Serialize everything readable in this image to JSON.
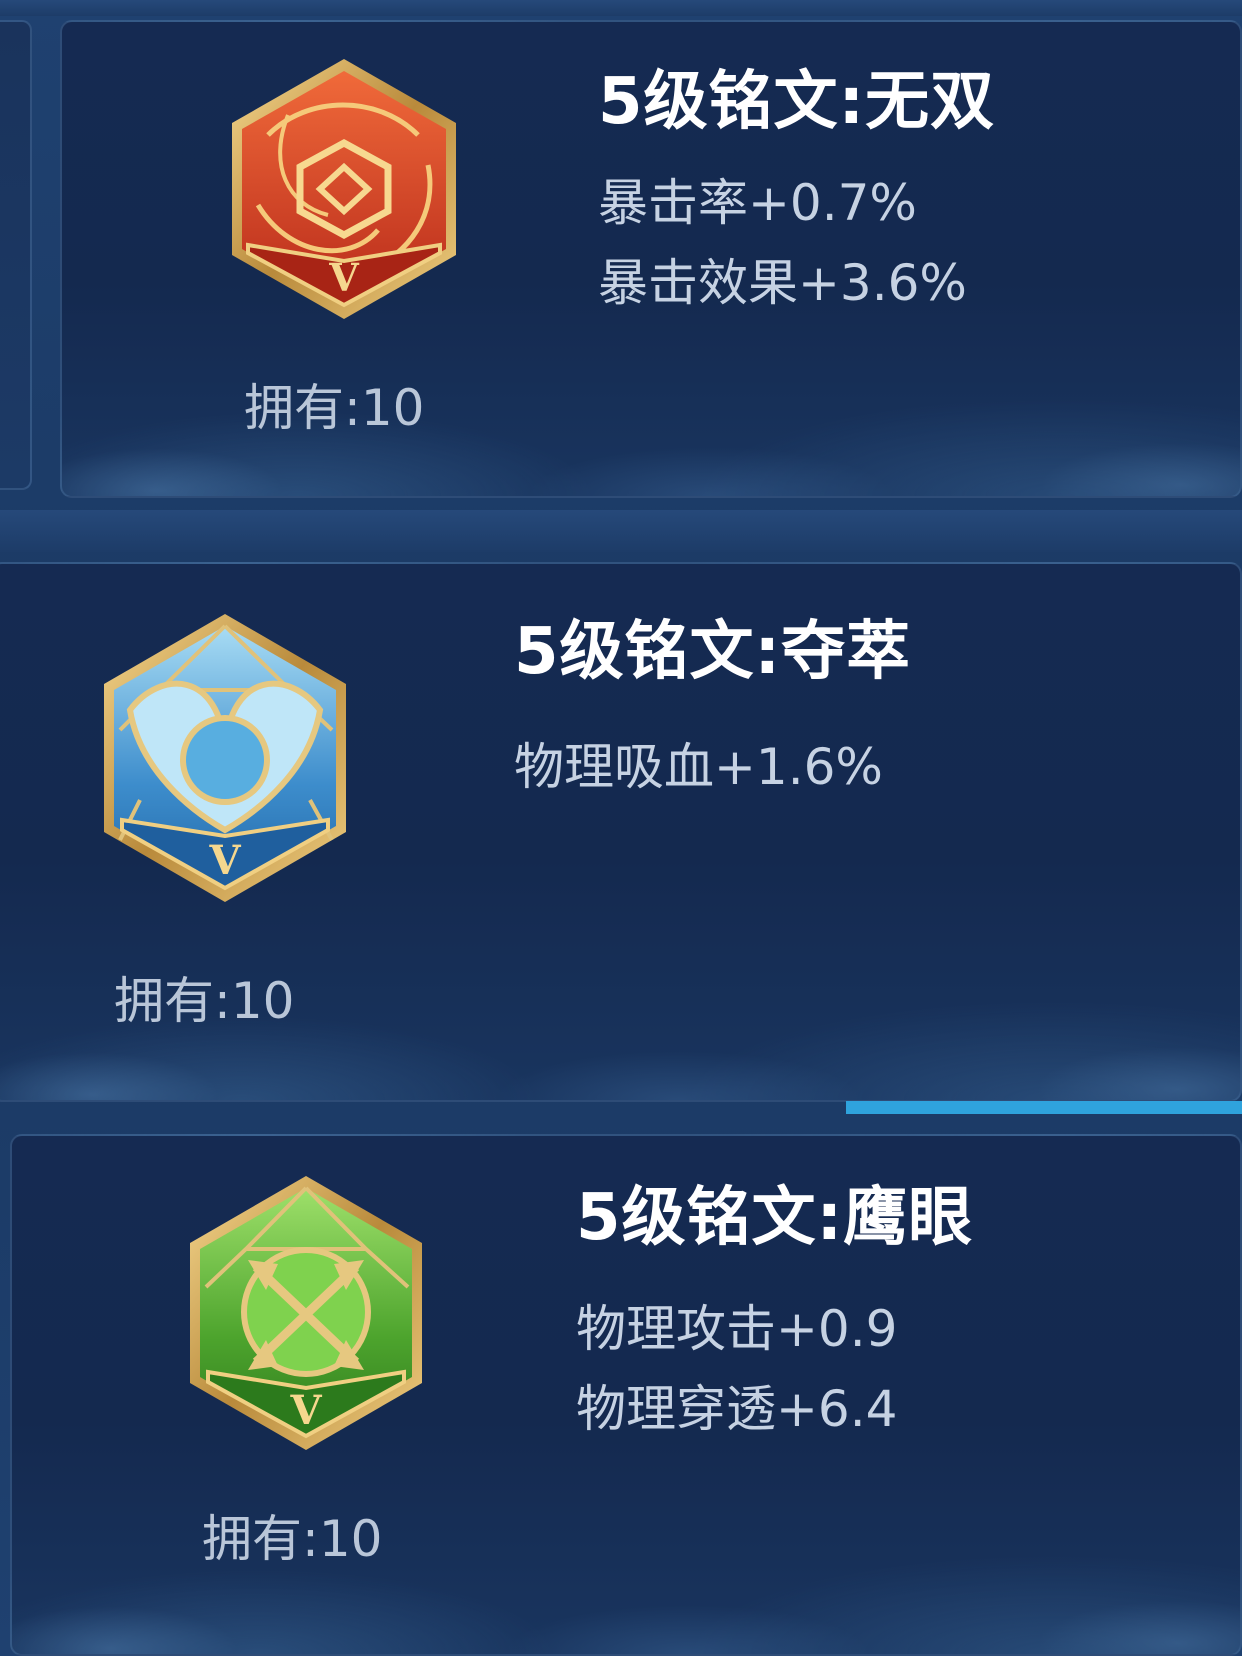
{
  "inscriptions": [
    {
      "title": "5级铭文:无双",
      "stats": [
        "暴击率+0.7%",
        "暴击效果+3.6%"
      ],
      "owned": "拥有:10",
      "emblem": "red-hexagon-emblem",
      "level_mark": "V",
      "color": "#d9462a"
    },
    {
      "title": "5级铭文:夺萃",
      "stats": [
        "物理吸血+1.6%"
      ],
      "owned": "拥有:10",
      "emblem": "blue-hexagon-emblem",
      "level_mark": "V",
      "color": "#4a9fd8"
    },
    {
      "title": "5级铭文:鹰眼",
      "stats": [
        "物理攻击+0.9",
        "物理穿透+6.4"
      ],
      "owned": "拥有:10",
      "emblem": "green-hexagon-emblem",
      "level_mark": "V",
      "color": "#5fbf3a"
    }
  ],
  "colors": {
    "gold": "#d9b46a",
    "title": "#ffffff",
    "stat": "#c6d2e3",
    "scroll_indicator": "#2fa3dd"
  }
}
